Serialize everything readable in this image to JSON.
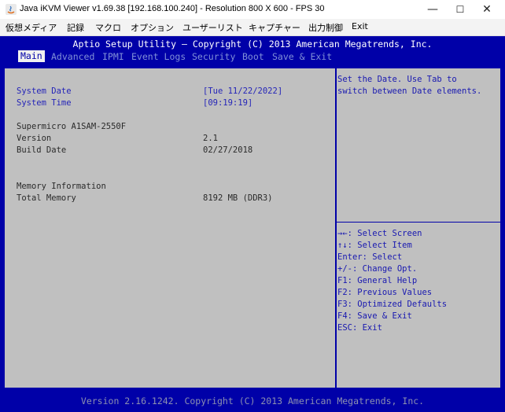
{
  "window": {
    "title": "Java iKVM Viewer v1.69.38 [192.168.100.240]  - Resolution 800 X 600 - FPS 30",
    "controls": {
      "minimize": "—",
      "maximize": "☐",
      "close": "✕"
    }
  },
  "menubar": [
    "仮想メディア",
    "記録",
    "マクロ",
    "オプション",
    "ユーザーリスト",
    "キャプチャー",
    "出力制御",
    "Exit"
  ],
  "bios": {
    "header": "Aptio Setup Utility – Copyright (C) 2013 American Megatrends, Inc.",
    "tabs": [
      "Main",
      "Advanced",
      "IPMI",
      "Event Logs",
      "Security",
      "Boot",
      "Save & Exit"
    ],
    "active_tab": "Main",
    "fields": {
      "system_date_label": "System Date",
      "system_date_value": "[Tue 11/22/2022]",
      "system_time_label": "System Time",
      "system_time_value": "[09:19:19]",
      "board": "Supermicro A1SAM-2550F",
      "version_label": "Version",
      "version_value": "2.1",
      "build_date_label": "Build Date",
      "build_date_value": "02/27/2018",
      "memory_info_label": "Memory Information",
      "total_memory_label": "Total Memory",
      "total_memory_value": "8192 MB (DDR3)"
    },
    "help_text": [
      "Set the Date. Use Tab to",
      "switch between Date elements."
    ],
    "key_help": [
      "→←: Select Screen",
      "↑↓: Select Item",
      "Enter: Select",
      "+/-: Change Opt.",
      "F1: General Help",
      "F2: Previous Values",
      "F3: Optimized Defaults",
      "F4: Save & Exit",
      "ESC: Exit"
    ],
    "footer": "Version 2.16.1242. Copyright (C) 2013 American Megatrends, Inc."
  },
  "colors": {
    "bios_blue": "#0000a8",
    "panel_gray": "#c0c0c0",
    "highlight_text": "#2424b8"
  }
}
